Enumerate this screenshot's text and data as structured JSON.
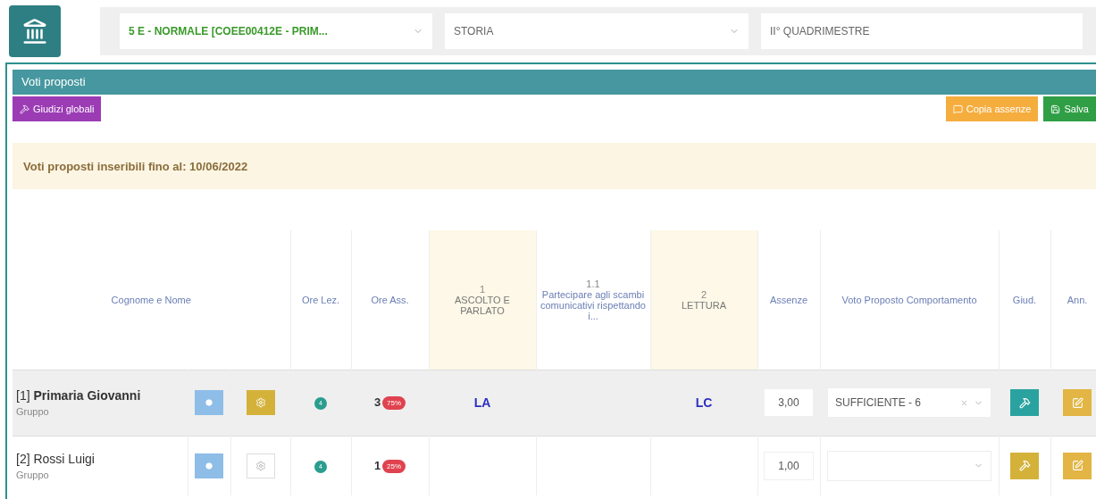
{
  "top_bar": {
    "class_select": "5 E - NORMALE [COEE00412E - PRIM...",
    "subject_select": "STORIA",
    "period_select": "II° QUADRIMESTRE"
  },
  "panel": {
    "title": "Voti proposti",
    "buttons": [
      {
        "label": "Giudizi globali",
        "kind": "global"
      },
      {
        "label": "Copia assenze",
        "kind": "copy"
      },
      {
        "label": "Salva",
        "kind": "save"
      }
    ],
    "notice": "Voti proposti inseribili fino al: 10/06/2022"
  },
  "table": {
    "columns": [
      {
        "label": "Cognome e Nome",
        "kind": "name"
      },
      {
        "label": "Ore Lez.",
        "kind": "plain"
      },
      {
        "label": "Ore Ass.",
        "kind": "plain"
      },
      {
        "number": "1",
        "label": "ASCOLTO E PARLATO",
        "kind": "area"
      },
      {
        "number": "1.1",
        "label": "Partecipare agli scambi comunicativi rispettando i...",
        "kind": "goal"
      },
      {
        "number": "2",
        "label": "LETTURA",
        "kind": "area"
      },
      {
        "label": "Assenze",
        "kind": "plain"
      },
      {
        "label": "Voto Proposto Comportamento",
        "kind": "plain"
      },
      {
        "label": "Giud.",
        "kind": "plain"
      },
      {
        "label": "Ann.",
        "kind": "plain"
      }
    ],
    "rows": [
      {
        "name": "[1] **Primaria Giovanni**",
        "group": "Gruppo",
        "highlighted": true,
        "option_active": true,
        "lessons": "4",
        "absent": "3",
        "absent_pct": "75%",
        "grade_1": "LA",
        "grade_2": "LC",
        "absences": "3,00",
        "behaviour": "SUFFICIENTE - 6",
        "judgement_set": true
      },
      {
        "name": "[2] Rossi Luigi",
        "group": "Gruppo",
        "highlighted": false,
        "option_active": false,
        "lessons": "4",
        "absent": "1",
        "absent_pct": "25%",
        "absences": "1,00",
        "judgement_set": false
      }
    ]
  }
}
